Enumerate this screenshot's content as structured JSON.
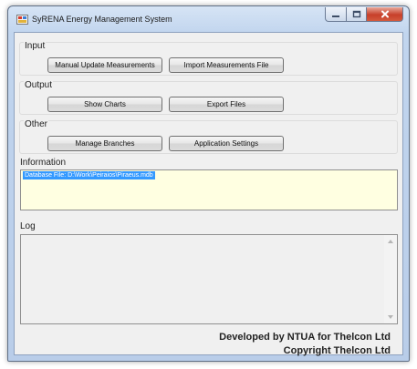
{
  "window": {
    "title": "SyRENA Energy Management System",
    "icons": {
      "app": "app-icon",
      "minimize": "minimize-icon",
      "maximize": "maximize-icon",
      "close": "close-icon"
    }
  },
  "groups": {
    "input": {
      "label": "Input",
      "buttons": [
        "Manual Update Measurements",
        "Import Measurements File"
      ]
    },
    "output": {
      "label": "Output",
      "buttons": [
        "Show Charts",
        "Export Files"
      ]
    },
    "other": {
      "label": "Other",
      "buttons": [
        "Manage Branches",
        "Application Settings"
      ]
    }
  },
  "information": {
    "label": "Information",
    "lines": [
      "Database File: D:\\Work\\Peiraios\\Piraeus.mdb"
    ]
  },
  "log": {
    "label": "Log",
    "value": ""
  },
  "footer": {
    "line1": "Developed by NTUA for Thelcon Ltd",
    "line2": "Copyright Thelcon Ltd"
  },
  "colors": {
    "info_background": "#ffffe1",
    "selection": "#3399ff",
    "close_button": "#c7402a"
  }
}
